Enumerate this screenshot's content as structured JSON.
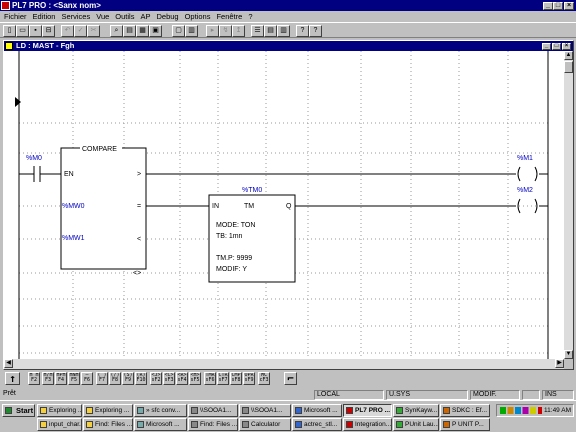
{
  "app": {
    "title": "PL7 PRO : <Sanx nom>",
    "window_controls": [
      "_",
      "□",
      "×"
    ]
  },
  "menu": [
    "Fichier",
    "Edition",
    "Services",
    "Vue",
    "Outils",
    "AP",
    "Debug",
    "Options",
    "Fenêtre",
    "?"
  ],
  "toolbar_icons": [
    "new-icon",
    "open-icon",
    "save-icon",
    "print-icon",
    "cut-icon",
    "copy-icon",
    "paste-icon",
    "undo-icon",
    "find-icon",
    "browse-icon",
    "variables-icon",
    "zoom-icon",
    "build-icon",
    "transfer-icon",
    "connect-icon",
    "run-icon",
    "stop-icon",
    "init-icon",
    "animation-icon",
    "tile-icon",
    "window-icon",
    "cascade-icon",
    "help-icon",
    "context-help-icon"
  ],
  "editor": {
    "title": "LD : MAST - Fgh",
    "window_controls": [
      "_",
      "□",
      "×"
    ]
  },
  "ladder": {
    "contact_m0": "%M0",
    "compare": {
      "title": "COMPARE",
      "in_label": "EN",
      "outputs": [
        ">",
        "=",
        "<",
        "<>"
      ],
      "operand1": "%MW0",
      "operand2": "%MW1"
    },
    "timer": {
      "name": "%TM0",
      "in_label": "IN",
      "tm_label": "TM",
      "q_label": "Q",
      "mode": "MODE: TON",
      "tb": "TB:  1mn",
      "tmp": "TM.P: 9999",
      "modif": "MODIF: Y"
    },
    "coil_m1": "%M1",
    "coil_m2": "%M2"
  },
  "ladder_palette": [
    {
      "top": "H H",
      "bottom": "F2"
    },
    {
      "top": "H/H",
      "bottom": "F3"
    },
    {
      "top": "HPH",
      "bottom": "F4"
    },
    {
      "top": "HNH",
      "bottom": "F5"
    },
    {
      "top": "—",
      "bottom": "F6"
    },
    {
      "top": "( )",
      "bottom": "F7"
    },
    {
      "top": "(/)",
      "bottom": "F8"
    },
    {
      "top": "(S)",
      "bottom": "F9"
    },
    {
      "top": "(R)",
      "bottom": "F10"
    },
    {
      "top": "<J>",
      "bottom": "sF2"
    },
    {
      "top": "<C>",
      "bottom": "sF3"
    },
    {
      "top": "<R>",
      "bottom": "sF4"
    },
    {
      "top": "<H>",
      "bottom": "sF5"
    },
    {
      "top": "TMR",
      "bottom": "sF6"
    },
    {
      "top": "CTR",
      "bottom": "sF7"
    },
    {
      "top": "CMP",
      "bottom": "sF8"
    },
    {
      "top": "OPR",
      "bottom": "sF9"
    },
    {
      "top": "FB",
      "bottom": "sF10"
    },
    {
      "top": "LBL",
      "bottom": "cF2"
    },
    {
      "top": "MC",
      "bottom": "cF3"
    },
    {
      "top": "FFB",
      "bottom": "cF4"
    },
    {
      "top": "CPL",
      "bottom": "cF5"
    }
  ],
  "status": {
    "ready": "Prêt",
    "mode": "LOCAL",
    "driver": "U.SYS",
    "modif": "MODIF.",
    "ins": "INS"
  },
  "taskbar": {
    "start": "Start",
    "row1": [
      "Exploring ...",
      "Exploring ...",
      "» sfc conv...",
      "\\\\SOOA1...",
      "\\\\SOOA1...",
      "Microsoft ...",
      "PL7 PRO ...",
      "SynKayw...",
      "SDKC : Ef..."
    ],
    "row2": [
      "input_char...",
      "Find: Files ...",
      "Microsoft ...",
      "Find: Files ...",
      "Calculator",
      "actrec_stl...",
      "Integration...",
      "PUnit Lau...",
      "P UNIT P..."
    ],
    "clock": "11:49 AM"
  },
  "colors": {
    "title_bar": "#000080",
    "ladder_blue": "#0000c0",
    "grid": "#9a9a9a"
  }
}
